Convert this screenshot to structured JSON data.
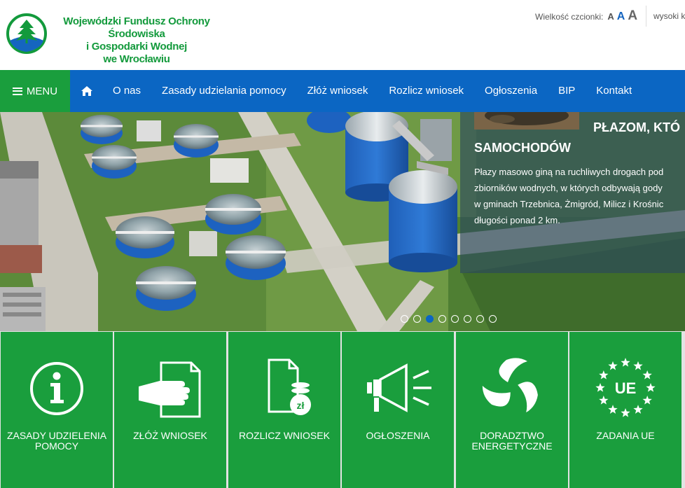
{
  "header": {
    "org_name_lines": [
      "Wojewódzki Fundusz Ochrony Środowiska",
      "i Gospodarki Wodnej",
      "we Wrocławiu"
    ],
    "font_size_label": "Wielkość czcionki:",
    "font_size_options": [
      "A",
      "A",
      "A"
    ],
    "contrast_label": "wysoki k"
  },
  "nav": {
    "menu_label": "MENU",
    "items": [
      {
        "label": "O nas"
      },
      {
        "label": "Zasady udzielania pomocy"
      },
      {
        "label": "Złóż wniosek"
      },
      {
        "label": "Rozlicz wniosek"
      },
      {
        "label": "Ogłoszenia"
      },
      {
        "label": "BIP"
      },
      {
        "label": "Kontakt"
      }
    ]
  },
  "slider": {
    "title_line1": "PŁAZOM, KTÓ",
    "title_line2": "SAMOCHODÓW",
    "body_lines": [
      "Płazy masowo giną na ruchliwych drogach pod",
      "zbiorników wodnych, w których odbywają gody",
      "w gminach Trzebnica, Żmigród, Milicz i Krośnic",
      "długości ponad 2 km."
    ],
    "dot_count": 8,
    "active_dot": 3
  },
  "tiles": [
    {
      "label": "Zasady udzielenia pomocy",
      "icon": "info-icon"
    },
    {
      "label": "Złóż wniosek",
      "icon": "hand-document-icon"
    },
    {
      "label": "Rozlicz wniosek",
      "icon": "document-coins-icon"
    },
    {
      "label": "Ogłoszenia",
      "icon": "megaphone-icon"
    },
    {
      "label": "Doradztwo energetyczne",
      "icon": "energy-swirl-icon"
    },
    {
      "label": "Zadania UE",
      "icon": "eu-stars-icon"
    }
  ],
  "icon_text": {
    "coin_symbol": "zł",
    "eu_text": "UE"
  },
  "colors": {
    "brand_green": "#1a9e3d",
    "nav_blue": "#0b66c3",
    "logo_green": "#139a3c"
  }
}
